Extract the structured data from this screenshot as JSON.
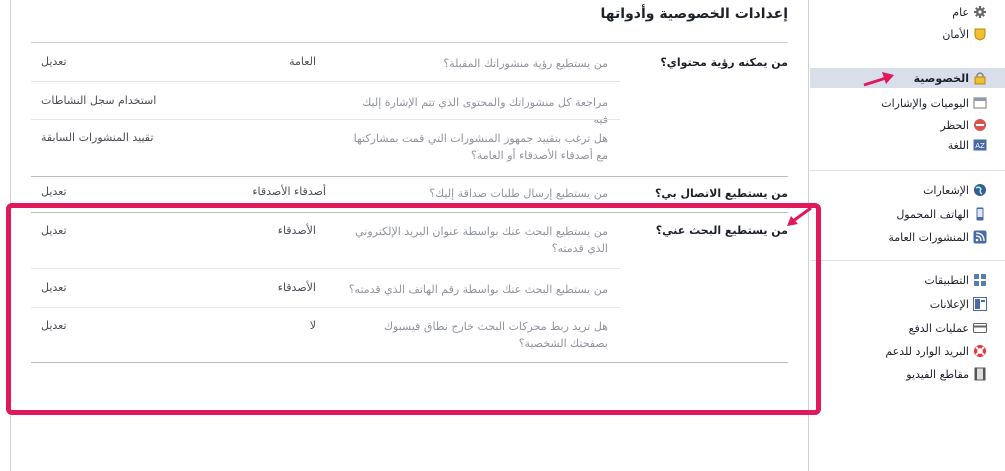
{
  "page": {
    "title": "إعدادات الخصوصية وأدواتها"
  },
  "sections": {
    "visibility": {
      "title": "من يمكنه رؤية محتواي؟",
      "rows": [
        {
          "question": "من يستطيع رؤية منشوراتك المقبلة؟",
          "value": "العامة",
          "action": "تعديل"
        },
        {
          "question": "مراجعة كل منشوراتك والمحتوى الذي تتم الإشارة إليك فيه",
          "value": "",
          "action": "استخدام سجل النشاطات"
        },
        {
          "question": "هل ترغب بتقييد جمهور المنشورات التي قمت بمشاركتها مع أصدقاء الأصدقاء أو العامة؟",
          "value": "",
          "action": "تقييد المنشورات السابقة"
        }
      ]
    },
    "contact": {
      "title": "من يستطيع الاتصال بي؟",
      "rows": [
        {
          "question": "من يستطيع إرسال طلبات صداقة إليك؟",
          "value": "أصدقاء الأصدقاء",
          "action": "تعديل"
        }
      ]
    },
    "lookup": {
      "title": "من يستطيع البحث عني؟",
      "rows": [
        {
          "question": "من يستطيع البحث عنك بواسطة عنوان البريد الإلكتروني الذي قدمته؟",
          "value": "الأصدقاء",
          "action": "تعديل"
        },
        {
          "question": "من يستطيع البحث عنك بواسطة رقم الهاتف الذي قدمته؟",
          "value": "الأصدقاء",
          "action": "تعديل"
        },
        {
          "question": "هل تريد ربط محركات البحث خارج نطاق فيسبوك بصفحتك الشخصية؟",
          "value": "لا",
          "action": "تعديل"
        }
      ]
    }
  },
  "sidebar": {
    "items": [
      {
        "label": "عام",
        "icon": "gear-icon"
      },
      {
        "label": "الأمان",
        "icon": "shield-icon"
      },
      {
        "label": "الخصوصية",
        "icon": "lock-icon",
        "active": true
      },
      {
        "label": "اليوميات والإشارات",
        "icon": "timeline-icon"
      },
      {
        "label": "الحظر",
        "icon": "block-icon"
      },
      {
        "label": "اللغة",
        "icon": "language-icon"
      },
      {
        "label": "الإشعارات",
        "icon": "globe-icon"
      },
      {
        "label": "الهاتف المحمول",
        "icon": "mobile-icon"
      },
      {
        "label": "المنشورات العامة",
        "icon": "rss-icon"
      },
      {
        "label": "التطبيقات",
        "icon": "apps-icon"
      },
      {
        "label": "الإعلانات",
        "icon": "ads-icon"
      },
      {
        "label": "عمليات الدفع",
        "icon": "card-icon"
      },
      {
        "label": "البريد الوارد للدعم",
        "icon": "lifebuoy-icon"
      },
      {
        "label": "مقاطع الفيديو",
        "icon": "film-icon"
      }
    ]
  },
  "colors": {
    "highlight": "#e0195a",
    "active_bg": "#d8dfea"
  }
}
